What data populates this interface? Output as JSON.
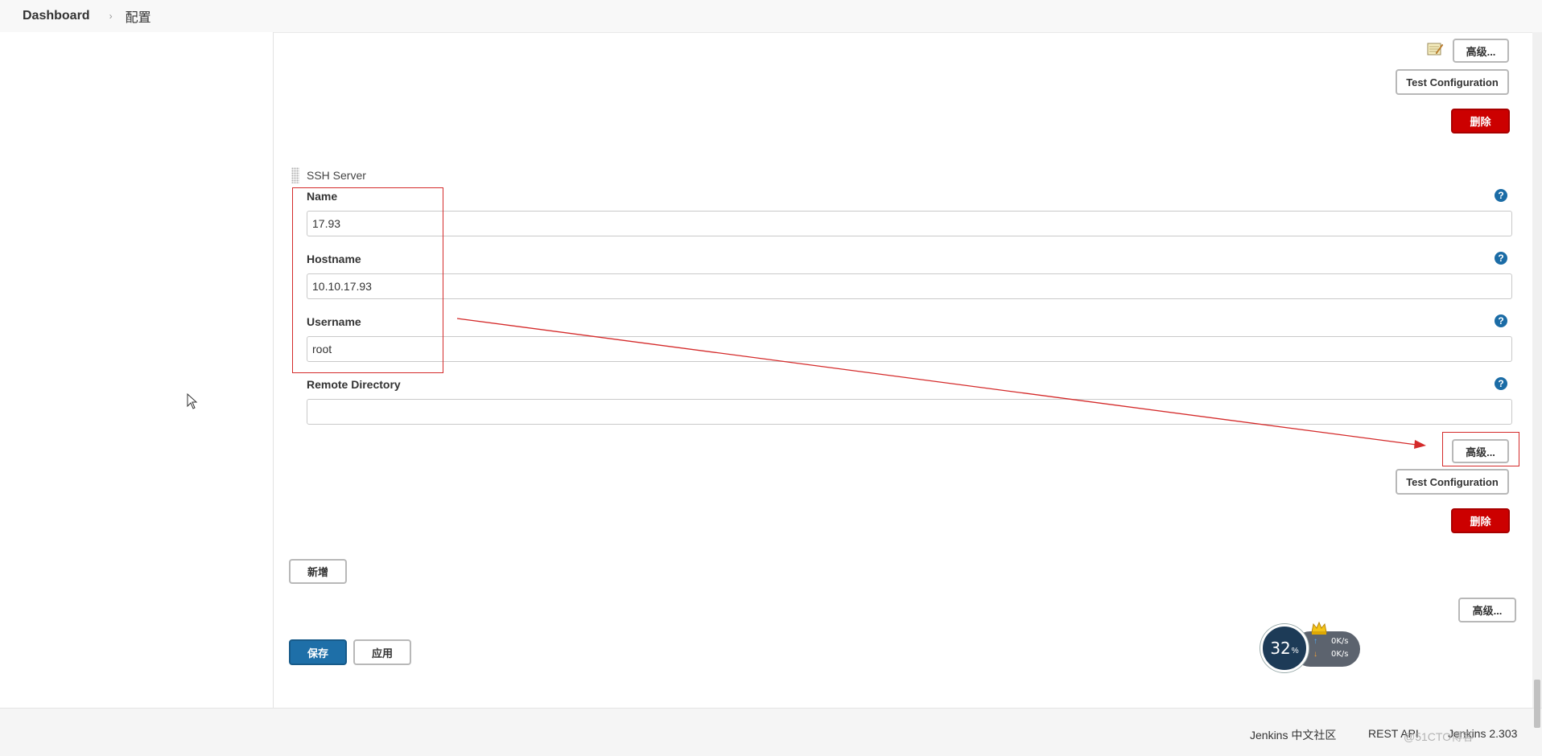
{
  "breadcrumb": {
    "home": "Dashboard",
    "separator": "›",
    "current": "配置"
  },
  "upper_server": {
    "advanced_label": "高级...",
    "test_label": "Test Configuration",
    "delete_label": "删除"
  },
  "ssh_server": {
    "title": "SSH Server",
    "name_label": "Name",
    "name_value": "17.93",
    "hostname_label": "Hostname",
    "hostname_value": "10.10.17.93",
    "username_label": "Username",
    "username_value": "root",
    "remote_dir_label": "Remote Directory",
    "remote_dir_value": "",
    "advanced_label": "高级...",
    "test_label": "Test Configuration",
    "delete_label": "删除"
  },
  "help_glyph": "?",
  "add_label": "新增",
  "advanced_bottom_label": "高级...",
  "save_label": "保存",
  "apply_label": "应用",
  "net_speed": {
    "percent": "32",
    "percent_sign": "%",
    "up_arrow": "↑",
    "down_arrow": "↓",
    "up_speed": "0K/s",
    "down_speed": "0K/s"
  },
  "footer": {
    "community": "Jenkins 中文社区",
    "rest_api": "REST API",
    "version": "Jenkins 2.303"
  },
  "watermark": "@51CTO博客",
  "colors": {
    "danger": "#cc0000",
    "primary": "#1e6fa8",
    "help": "#1b6ca6",
    "annotation": "#d42a2a"
  }
}
